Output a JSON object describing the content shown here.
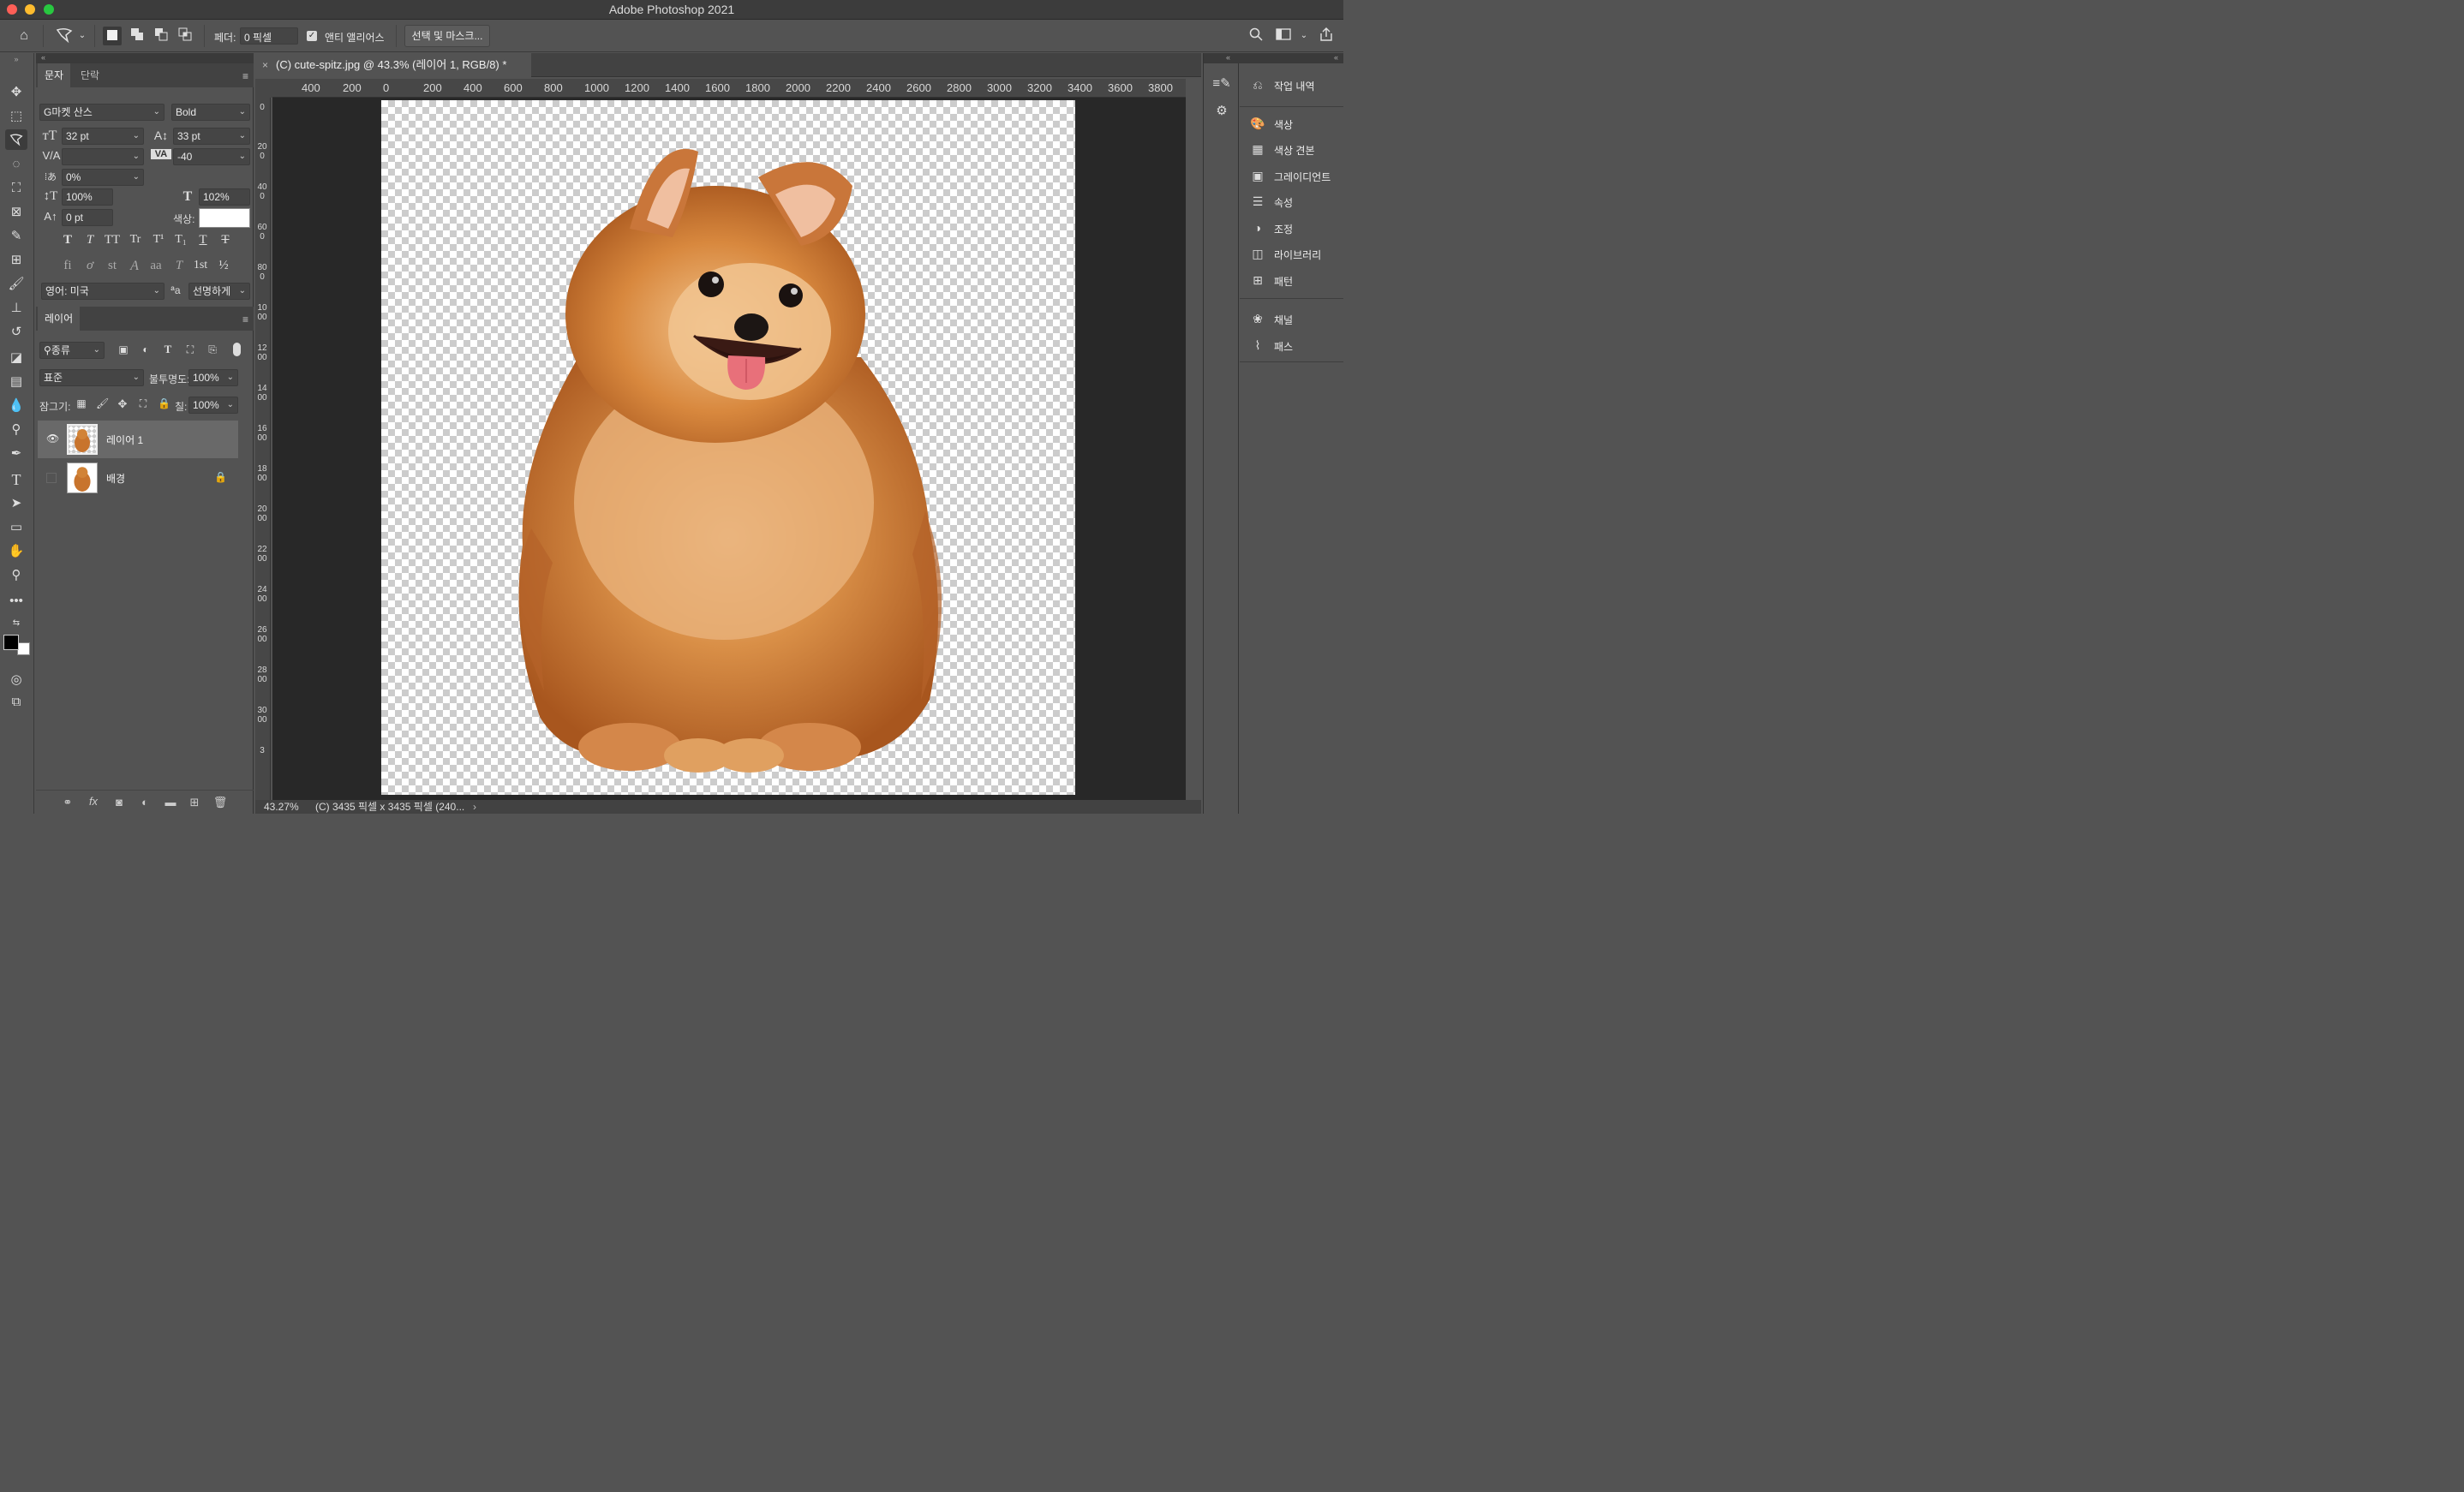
{
  "window": {
    "title": "Adobe Photoshop 2021"
  },
  "options_bar": {
    "feather_label": "페더:",
    "feather_value": "0 픽셀",
    "antialias_label": "앤티 앨리어스",
    "select_mask_button": "선택 및 마스크..."
  },
  "character_panel": {
    "tabs": [
      "문자",
      "단락"
    ],
    "font_family": "G마켓 산스",
    "font_style": "Bold",
    "font_size": "32 pt",
    "leading": "33 pt",
    "kerning": "",
    "tracking": "-40",
    "tsume": "0%",
    "vertical_scale": "100%",
    "horizontal_scale": "102%",
    "baseline_shift": "0 pt",
    "color_label": "색상:",
    "language": "영어: 미국",
    "antialias_glyph": "a",
    "antialias_method": "선명하게",
    "style_buttons": [
      "T",
      "T",
      "TT",
      "Tr",
      "T¹",
      "T₁",
      "T",
      "T"
    ],
    "opentype_buttons": [
      "fi",
      "ơ",
      "st",
      "A",
      "aa",
      "T",
      "1st",
      "½"
    ]
  },
  "layers_panel": {
    "tab": "레이어",
    "filter_kind": "종류",
    "blend_mode": "표준",
    "opacity_label": "불투명도:",
    "opacity_value": "100%",
    "lock_label": "잠그기:",
    "fill_label": "칠:",
    "fill_value": "100%",
    "layers": [
      {
        "name": "레이어 1",
        "visible": true,
        "selected": true
      },
      {
        "name": "배경",
        "visible": false,
        "locked": true
      }
    ]
  },
  "document": {
    "tab_title": "(C) cute-spitz.jpg @ 43.3% (레이어 1, RGB/8) *",
    "ruler_h_labels": [
      "400",
      "200",
      "0",
      "200",
      "400",
      "600",
      "800",
      "1000",
      "1200",
      "1400",
      "1600",
      "1800",
      "2000",
      "2200",
      "2400",
      "2600",
      "2800",
      "3000",
      "3200",
      "3400",
      "3600",
      "3800"
    ],
    "ruler_v_labels": [
      "0",
      "200",
      "400",
      "600",
      "800",
      "1000",
      "1200",
      "1400",
      "1600",
      "1800",
      "2000",
      "2200",
      "2400",
      "2600",
      "2800",
      "3000",
      "3"
    ],
    "zoom": "43.27%",
    "doc_info": "(C) 3435 픽셀 x 3435 픽셀 (240..."
  },
  "right_panels": {
    "group1": [
      "작업 내역"
    ],
    "group2": [
      "색상",
      "색상 견본",
      "그레이디언트",
      "속성",
      "조정",
      "라이브러리",
      "패턴"
    ],
    "group3": [
      "채널",
      "패스"
    ]
  },
  "colors": {
    "foreground": "#000000",
    "background": "#ffffff"
  }
}
